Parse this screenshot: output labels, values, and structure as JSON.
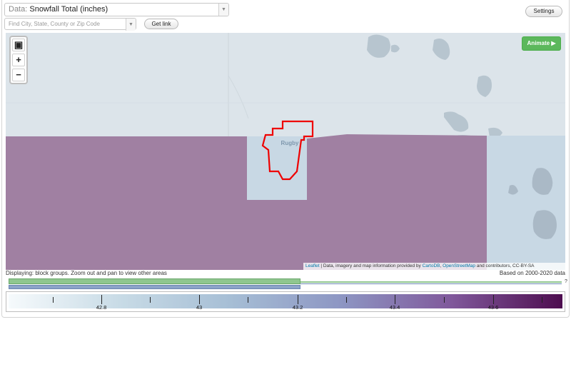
{
  "controls": {
    "data_prefix": "Data:",
    "data_value": "Snowfall Total (inches)",
    "find_placeholder": "Find City, State, County or Zip Code",
    "get_link_label": "Get link",
    "settings_label": "Settings",
    "animate_label": "Animate ▶",
    "zoom_in": "+",
    "zoom_out": "−"
  },
  "map": {
    "city_label": "Rugby",
    "attribution": {
      "leaflet": "Leaflet",
      "text1": " | Data, imagery and map information provided by ",
      "cartodb": "CartoDB",
      "sep": ", ",
      "osm": "OpenStreetMap",
      "text2": " and contributors, CC-BY-SA"
    },
    "colors": {
      "base": "#dce4ea",
      "purple_region": "#a080a2",
      "light_blue_region": "#c8d8e4",
      "water": "#b7c5cf",
      "selection": "#ee0000"
    }
  },
  "status": {
    "displaying": "Displaying: block groups. Zoom out and pan to view other areas",
    "based_on": "Based on 2000-2020 data",
    "timeline_marker": "?"
  },
  "legend": {
    "labels": [
      "42.8",
      "43",
      "43.2",
      "43.4",
      "43.6"
    ],
    "colors": [
      "#f6fafc",
      "#c8dbe6",
      "#a6bed5",
      "#8d96c3",
      "#80589b",
      "#4d0d4f"
    ]
  }
}
